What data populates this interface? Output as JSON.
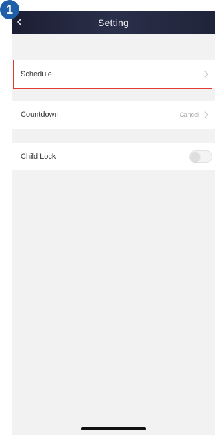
{
  "step_badge": "1",
  "navbar": {
    "title": "Setting",
    "back_icon": "chevron-left-icon"
  },
  "settings": {
    "schedule": {
      "label": "Schedule",
      "highlighted": true,
      "highlight_color": "#e23a2e"
    },
    "countdown": {
      "label": "Countdown",
      "value": "Cancel"
    },
    "child_lock": {
      "label": "Child Lock",
      "enabled": false
    }
  },
  "colors": {
    "navbar": "#23273f",
    "background": "#f2f2f2",
    "badge": "#1f5fa8"
  }
}
